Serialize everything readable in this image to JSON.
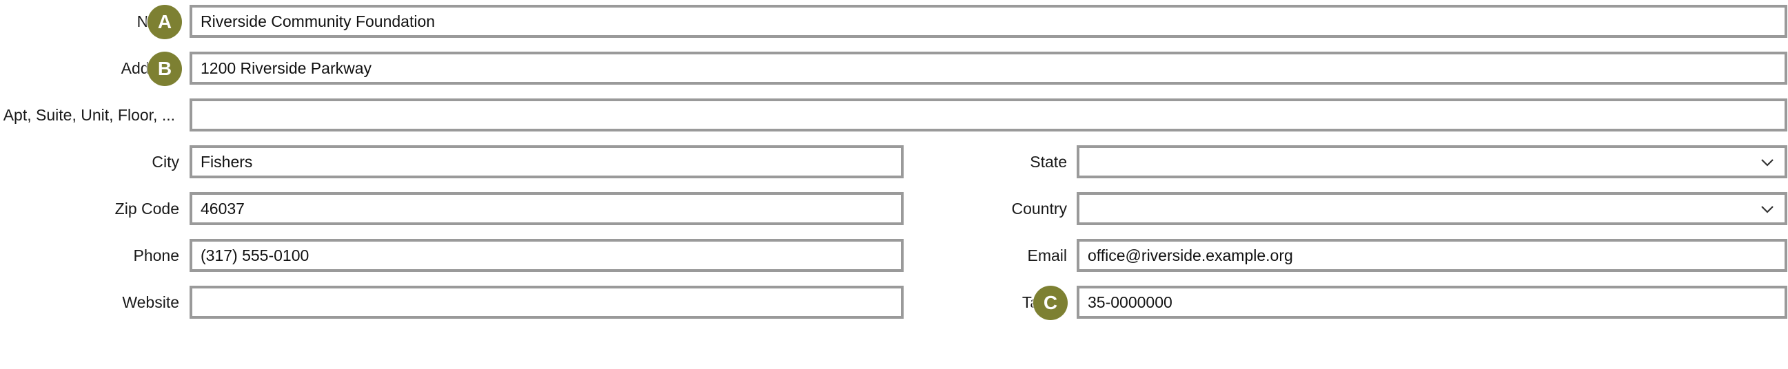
{
  "form": {
    "name": {
      "label": "Name",
      "value": "Riverside Community Foundation",
      "placeholder": ""
    },
    "address": {
      "label": "Address",
      "value": "1200 Riverside Parkway",
      "placeholder": ""
    },
    "address2": {
      "label": "Apt, Suite, Unit, Floor, ...",
      "value": "",
      "placeholder": ""
    },
    "city": {
      "label": "City",
      "value": "Fishers",
      "placeholder": ""
    },
    "state": {
      "label": "State",
      "value": "",
      "icon": "chevron-down-icon"
    },
    "zip": {
      "label": "Zip Code",
      "value": "46037",
      "placeholder": ""
    },
    "country": {
      "label": "Country",
      "value": "",
      "icon": "chevron-down-icon"
    },
    "phone": {
      "label": "Phone",
      "value": "(317) 555-0100",
      "placeholder": ""
    },
    "email": {
      "label": "Email",
      "value": "office@riverside.example.org",
      "placeholder": ""
    },
    "website": {
      "label": "Website",
      "value": "",
      "placeholder": ""
    },
    "tax_id": {
      "label": "Tax ID",
      "value": "35-0000000",
      "placeholder": ""
    }
  },
  "badges": {
    "a": "A",
    "b": "B",
    "c": "C"
  },
  "colors": {
    "badge": "#7d8032",
    "border": "#9a9a9a",
    "text": "#1a1a1a"
  }
}
